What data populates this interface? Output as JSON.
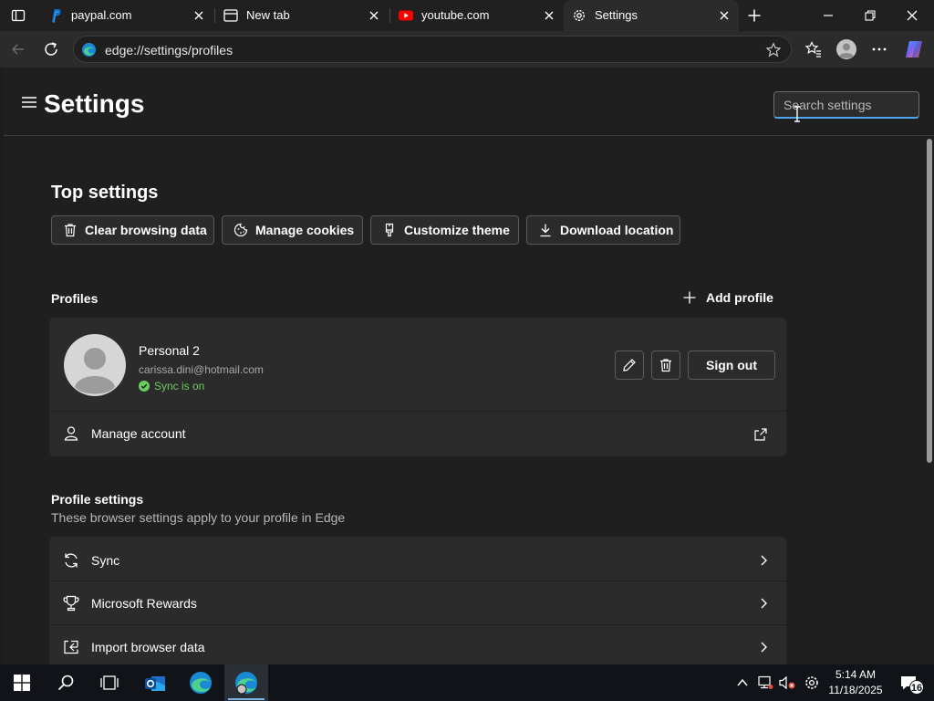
{
  "tabs": [
    {
      "title": "paypal.com",
      "favicon": "paypal-icon"
    },
    {
      "title": "New tab",
      "favicon": "newtab-icon"
    },
    {
      "title": "youtube.com",
      "favicon": "youtube-icon"
    },
    {
      "title": "Settings",
      "favicon": "gear-icon",
      "active": true
    }
  ],
  "address_bar": {
    "url": "edge://settings/profiles"
  },
  "settings": {
    "title": "Settings",
    "search_placeholder": "Search settings",
    "top_settings": {
      "title": "Top settings",
      "buttons": [
        {
          "label": "Clear browsing data",
          "icon": "trash-icon"
        },
        {
          "label": "Manage cookies",
          "icon": "cookie-icon"
        },
        {
          "label": "Customize theme",
          "icon": "brush-icon"
        },
        {
          "label": "Download location",
          "icon": "download-icon"
        }
      ]
    },
    "profiles": {
      "title": "Profiles",
      "add_label": "Add profile",
      "profile": {
        "name": "Personal 2",
        "email": "carissa.dini@hotmail.com",
        "sync_status": "Sync is on",
        "signout_label": "Sign out"
      },
      "manage_label": "Manage account"
    },
    "profile_settings": {
      "title": "Profile settings",
      "subtitle": "These browser settings apply to your profile in Edge",
      "rows": [
        {
          "label": "Sync",
          "icon": "sync-icon"
        },
        {
          "label": "Microsoft Rewards",
          "icon": "trophy-icon"
        },
        {
          "label": "Import browser data",
          "icon": "import-icon"
        }
      ]
    }
  },
  "taskbar": {
    "time": "5:14 AM",
    "date": "11/18/2025",
    "notifications": "16"
  },
  "colors": {
    "accent": "#4ea3f2",
    "sync_ok": "#6ccb5f",
    "page_bg": "#1f1f1f",
    "card_bg": "#2b2b2b"
  }
}
